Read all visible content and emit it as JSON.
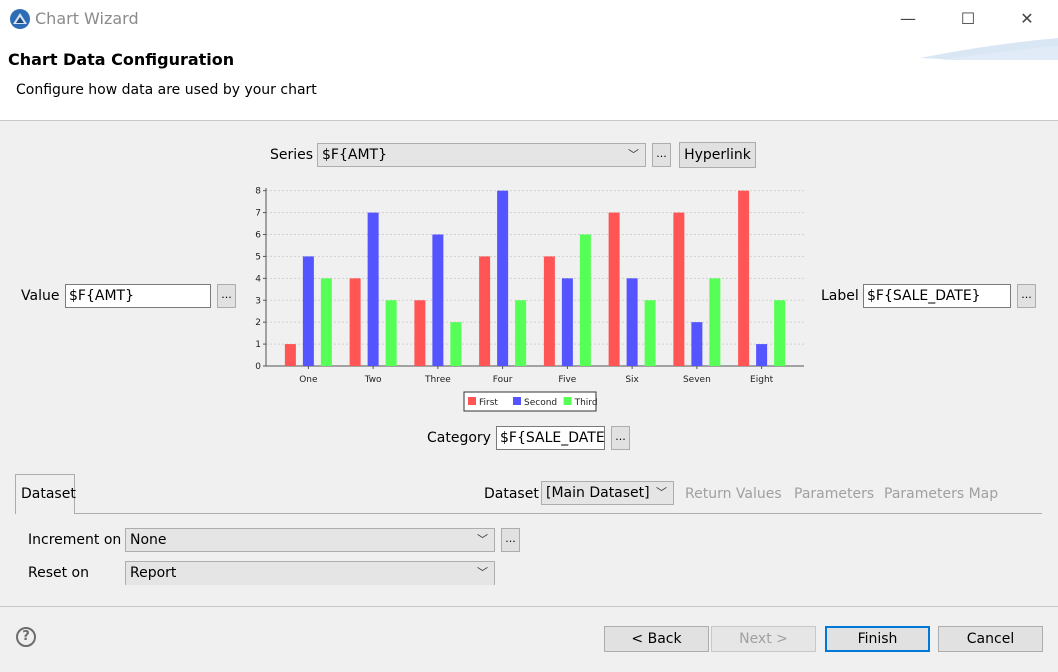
{
  "window": {
    "title": "Chart Wizard",
    "controls": [
      "—",
      "☐",
      "✕"
    ]
  },
  "header": {
    "title": "Chart Data Configuration",
    "description": "Configure how data are used by your chart"
  },
  "series": {
    "label": "Series",
    "value": "$F{AMT}",
    "browse_label": "...",
    "hyperlink_label": "Hyperlink"
  },
  "value_field": {
    "label": "Value",
    "value": "$F{AMT}",
    "browse_label": "..."
  },
  "label_field": {
    "label": "Label",
    "value": "$F{SALE_DATE}",
    "browse_label": "..."
  },
  "category_field": {
    "label": "Category",
    "value": "$F{SALE_DATE",
    "browse_label": "..."
  },
  "chart_data": {
    "type": "bar",
    "categories": [
      "One",
      "Two",
      "Three",
      "Four",
      "Five",
      "Six",
      "Seven",
      "Eight"
    ],
    "series": [
      {
        "name": "First",
        "color": "#ff5555",
        "values": [
          1,
          4,
          3,
          5,
          5,
          7,
          7,
          8
        ]
      },
      {
        "name": "Second",
        "color": "#5555ff",
        "values": [
          5,
          7,
          6,
          8,
          4,
          4,
          2,
          1
        ]
      },
      {
        "name": "Third",
        "color": "#55ff55",
        "values": [
          4,
          3,
          2,
          3,
          6,
          3,
          4,
          3
        ]
      }
    ],
    "ylim": [
      0,
      8
    ],
    "yticks": [
      "0",
      "1",
      "2",
      "3",
      "4",
      "5",
      "6",
      "7",
      "8"
    ],
    "grid": true,
    "legend": "bottom"
  },
  "tabs": {
    "dataset_tab": "Dataset",
    "dataset_label": "Dataset",
    "dataset_value": "[Main Dataset]",
    "return_values": "Return Values",
    "parameters": "Parameters",
    "parameters_map": "Parameters Map"
  },
  "increment": {
    "label": "Increment on",
    "value": "None",
    "browse_label": "..."
  },
  "reset": {
    "label": "Reset on",
    "value": "Report"
  },
  "footer": {
    "help": "?",
    "back": "< Back",
    "next": "Next >",
    "finish": "Finish",
    "cancel": "Cancel"
  }
}
